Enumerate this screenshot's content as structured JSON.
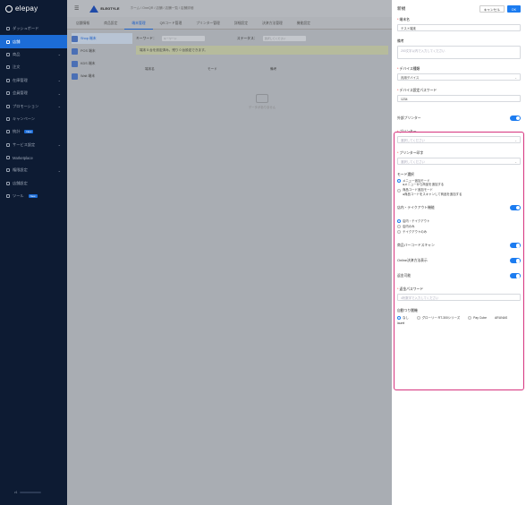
{
  "sidebar": {
    "brand": "elepay",
    "items": [
      {
        "label": "ダッシュボード",
        "chev": "",
        "badge": ""
      },
      {
        "label": "店舗",
        "chev": "",
        "badge": ""
      },
      {
        "label": "商品",
        "chev": "⌄",
        "badge": ""
      },
      {
        "label": "注文",
        "chev": "",
        "badge": ""
      },
      {
        "label": "在庫管理",
        "chev": "⌄",
        "badge": ""
      },
      {
        "label": "会員管理",
        "chev": "⌄",
        "badge": ""
      },
      {
        "label": "プロモーション",
        "chev": "⌄",
        "badge": ""
      },
      {
        "label": "キャンペーン",
        "chev": "",
        "badge": ""
      },
      {
        "label": "統計",
        "chev": "",
        "badge": "New"
      },
      {
        "label": "サービス設定",
        "chev": "⌄",
        "badge": ""
      },
      {
        "label": "Marketplace",
        "chev": "",
        "badge": ""
      },
      {
        "label": "権限設定",
        "chev": "⌄",
        "badge": ""
      },
      {
        "label": "店舗設定",
        "chev": "",
        "badge": ""
      },
      {
        "label": "ツール",
        "chev": "",
        "badge": "New"
      }
    ],
    "footer_version": "v1"
  },
  "topbar": {
    "brand": "ELEGTYLE",
    "breadcrumb": "ホーム / OneQR / 店舗 / 店舗一覧 / 店舗詳細"
  },
  "tabs": [
    "店舗情報",
    "商品設定",
    "端末管理",
    "QRコード管理",
    "プリンター管理",
    "詳細設定",
    "決済方法管理",
    "機能設定"
  ],
  "devices": [
    "Shop 端末",
    "POS 端末",
    "KDS 端末",
    "Wait 端末"
  ],
  "filter": {
    "keyword_label": "キーワード：",
    "keyword_placeholder": "キーワード",
    "status_label": "ステータス：",
    "status_placeholder": "選択してください"
  },
  "notice": "端末 5 台を設定済み。残り 0 台設定できます。",
  "table_headers": [
    "端末名",
    "モード",
    "備考"
  ],
  "empty_text": "データがありません",
  "drawer": {
    "title": "新規",
    "cancel": "キャンセル",
    "ok": "OK",
    "device_name_label": "端末名",
    "device_name_value": "テスト端末",
    "memo_label": "備考",
    "memo_placeholder": "200文字以内で入力してください",
    "device_type_label": "デバイス種類",
    "device_type_value": "汎用デバイス",
    "device_pw_label": "デバイス設定パスワード",
    "device_pw_value": "1234",
    "external_printer_label": "外部プリンター",
    "printer_label": "プリンター",
    "printer_placeholder": "選択してください",
    "printer_lang_label": "プリンター印字",
    "printer_lang_placeholder": "選択してください",
    "mode_label": "モード選択",
    "mode_options": [
      {
        "title": "メニュー追加モード",
        "sub": "●メニューから商品を追加する",
        "on": true
      },
      {
        "title": "商品コード追加モード",
        "sub": "●商品コードをスキャンして商品を追加する",
        "on": false
      }
    ],
    "eatin_label": "店内・テイクアウト機能",
    "eatin_options": [
      {
        "title": "店内・テイクアウト",
        "on": true
      },
      {
        "title": "店内のみ",
        "on": false
      },
      {
        "title": "テイクアウトのみ",
        "on": false
      }
    ],
    "barcode_label": "商品バーコードスキャン",
    "online_label": "Online決済方法表示",
    "refund_label": "返金可能",
    "refund_pw_label": "返金パスワード",
    "refund_pw_placeholder": "4桁数字で入力してください",
    "auto_pay_label": "自動つり銭機",
    "auto_pay_options": [
      {
        "title": "なし",
        "on": true
      },
      {
        "title": "グローリー RT-300シリーズ",
        "on": false
      },
      {
        "title": "Pay Cube",
        "on": false
      },
      {
        "title": "ARUNAS",
        "on": false
      },
      {
        "title": "laurel",
        "on": false
      }
    ]
  }
}
